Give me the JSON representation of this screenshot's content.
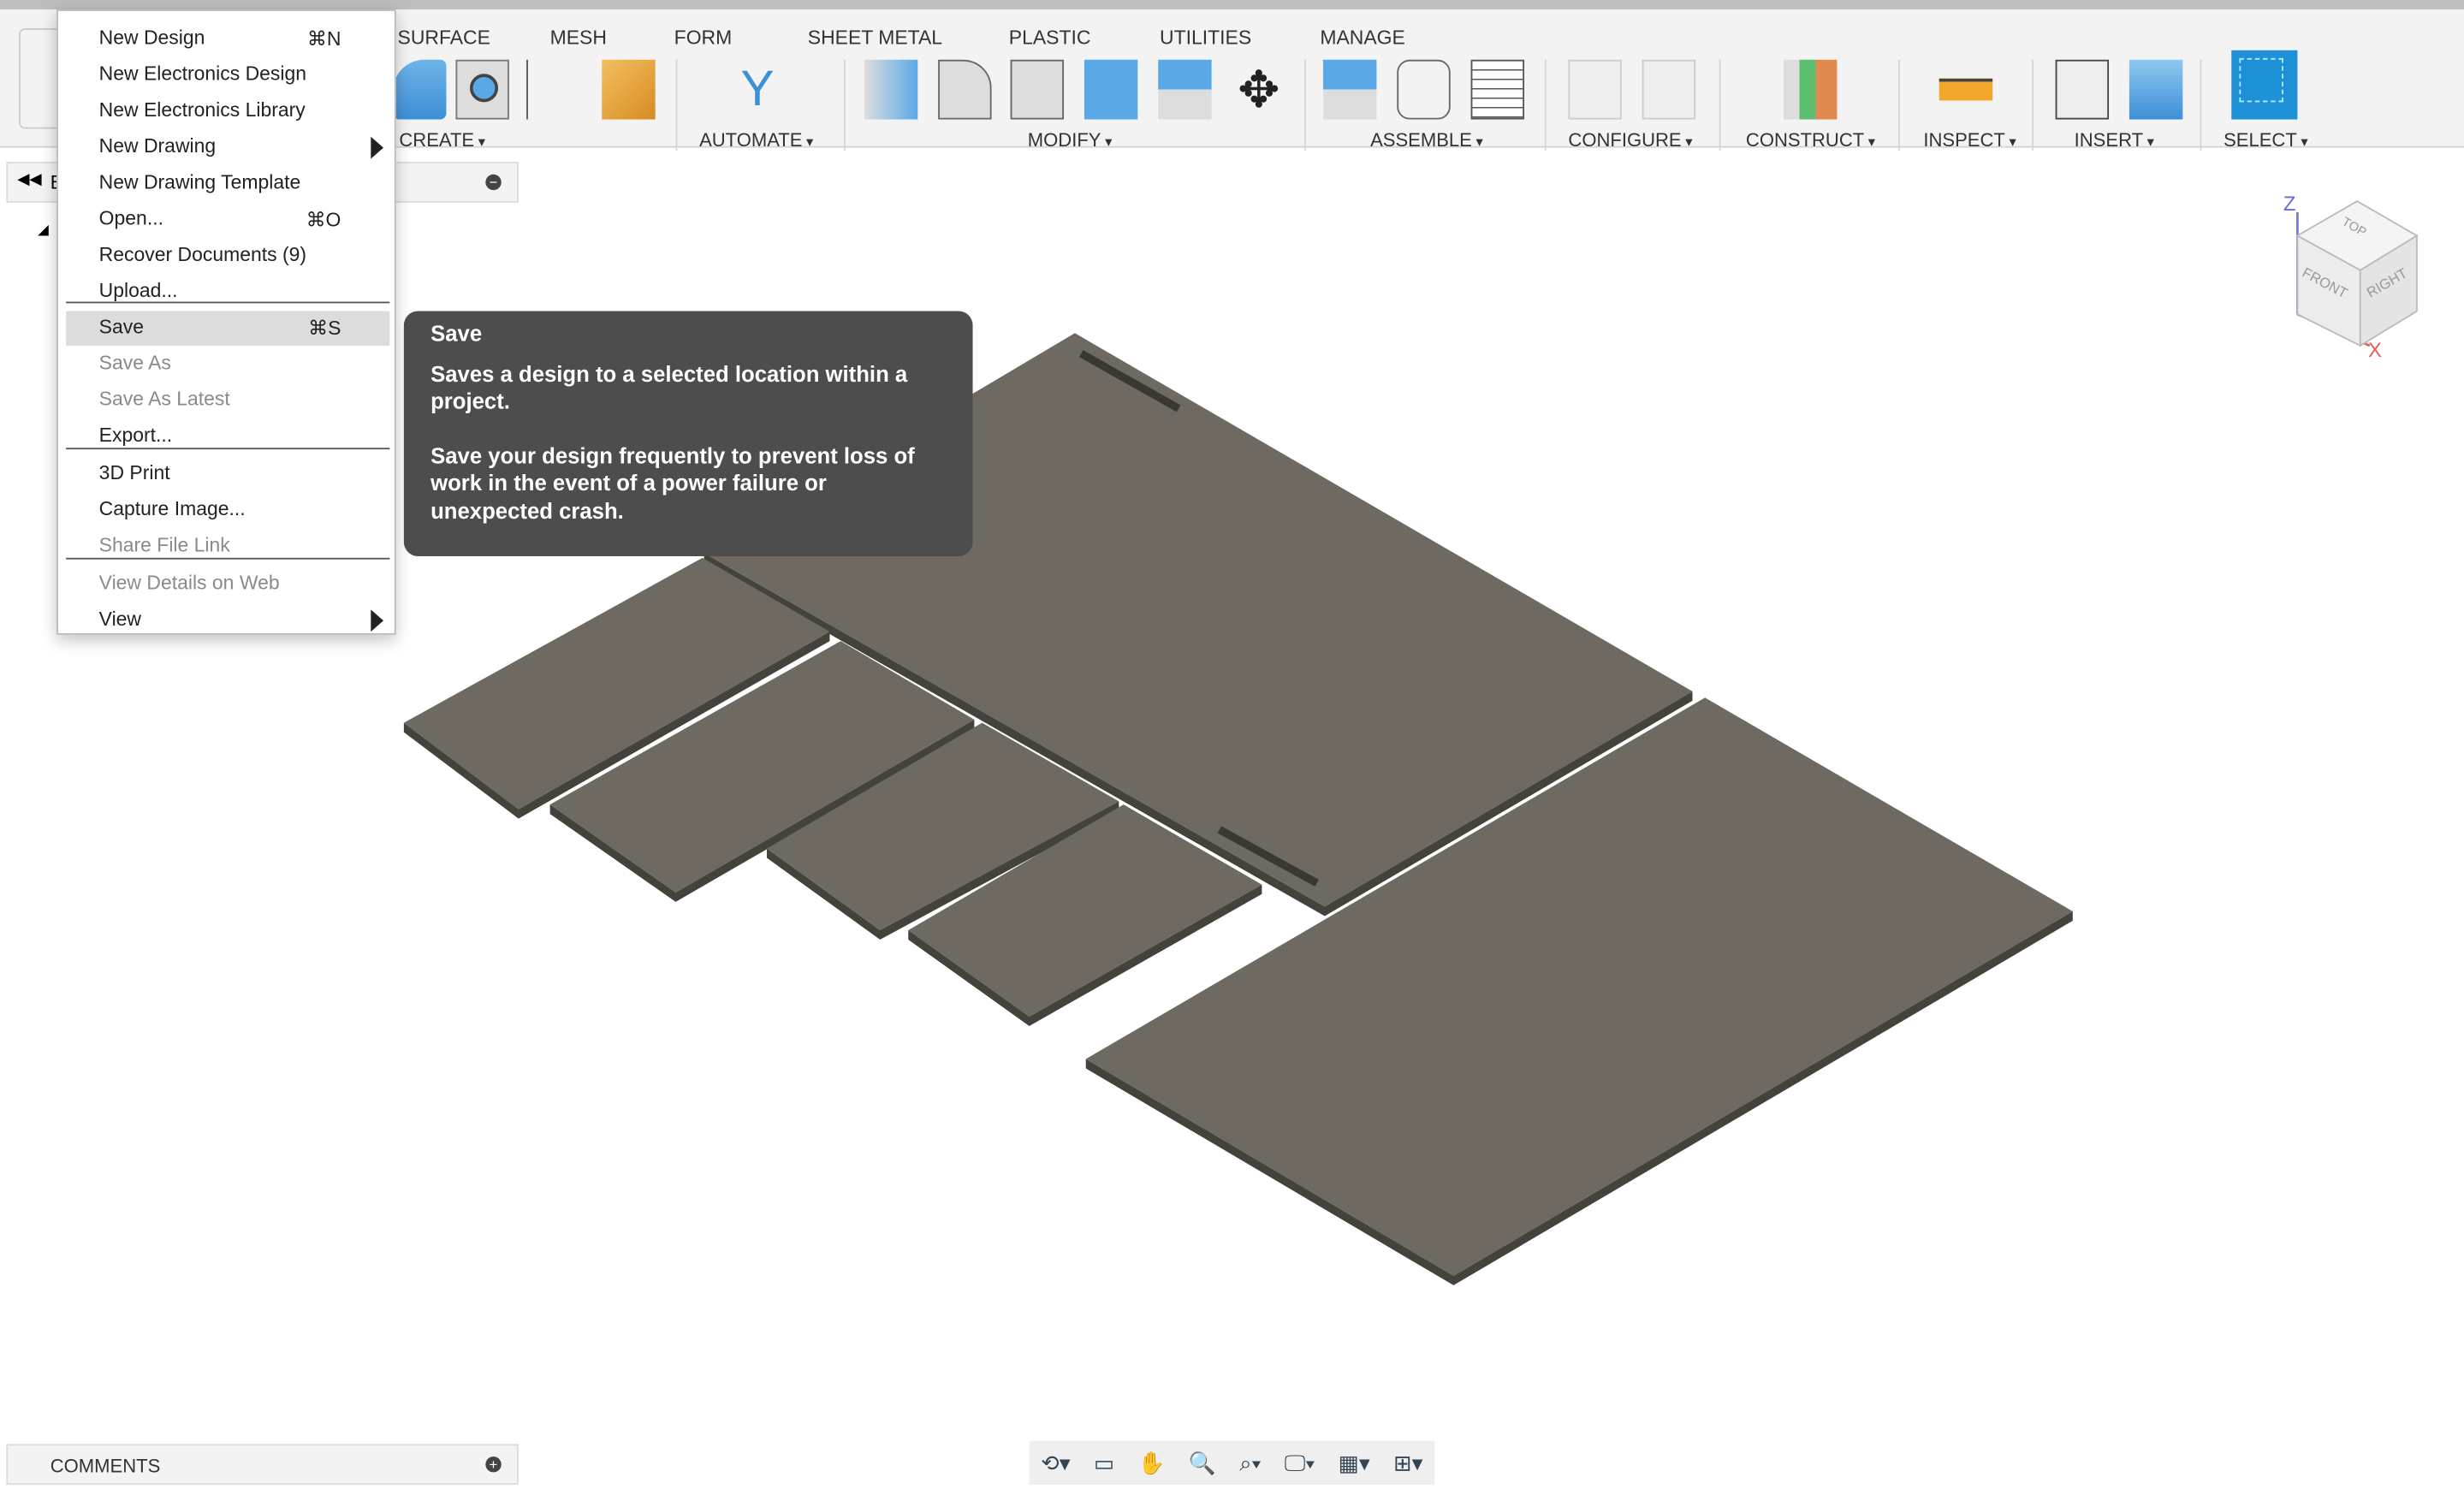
{
  "workspace_tabs": [
    "SURFACE",
    "MESH",
    "FORM",
    "SHEET METAL",
    "PLASTIC",
    "UTILITIES",
    "MANAGE"
  ],
  "groups": [
    "CREATE",
    "AUTOMATE",
    "MODIFY",
    "ASSEMBLE",
    "CONFIGURE",
    "CONSTRUCT",
    "INSPECT",
    "INSERT",
    "SELECT"
  ],
  "browser": {
    "label": "B"
  },
  "comments": {
    "label": "COMMENTS"
  },
  "file_menu": {
    "items": [
      {
        "label": "New Design",
        "shortcut": "⌘N"
      },
      {
        "label": "New Electronics Design"
      },
      {
        "label": "New Electronics Library"
      },
      {
        "label": "New Drawing",
        "submenu": true
      },
      {
        "label": "New Drawing Template"
      },
      {
        "label": "Open...",
        "shortcut": "⌘O"
      },
      {
        "label": "Recover Documents (9)"
      },
      {
        "label": "Upload..."
      },
      {
        "label": "Save",
        "shortcut": "⌘S",
        "highlighted": true
      },
      {
        "label": "Save As",
        "disabled": true
      },
      {
        "label": "Save As Latest",
        "disabled": true
      },
      {
        "label": "Export..."
      },
      {
        "label": "3D Print"
      },
      {
        "label": "Capture Image..."
      },
      {
        "label": "Share File Link",
        "disabled": true
      },
      {
        "label": "View Details on Web",
        "disabled": true
      },
      {
        "label": "View",
        "submenu": true
      }
    ]
  },
  "tooltip": {
    "title": "Save",
    "line1": "Saves a design to a selected location within a project.",
    "line2": "Save your design frequently to prevent loss of work in the event of a power failure or unexpected crash."
  },
  "viewcube": {
    "top": "TOP",
    "front": "FRONT",
    "right": "RIGHT",
    "z": "Z",
    "x": "X"
  },
  "colors": {
    "plate_face": "#6e6a61",
    "plate_edge": "#45423c",
    "tooltip_bg": "#4d4d4d",
    "select_blue": "#1e90d6"
  }
}
